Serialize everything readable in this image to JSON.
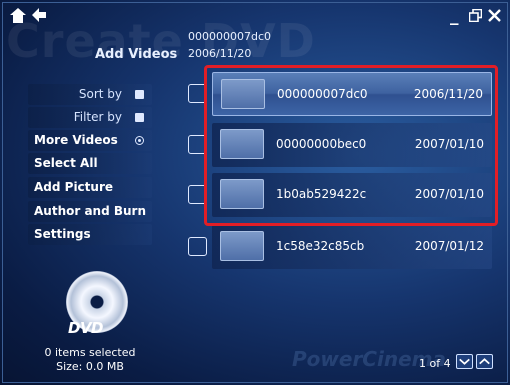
{
  "window": {
    "watermark": "Create DVD",
    "brand": "PowerCinema"
  },
  "header": {
    "title": "Add Videos",
    "current_id": "000000007dc0",
    "current_date": "2006/11/20"
  },
  "menu": {
    "sort_by": "Sort by",
    "filter_by": "Filter by",
    "more_videos": "More Videos",
    "select_all": "Select All",
    "add_picture": "Add Picture",
    "author_and_burn": "Author and Burn",
    "settings": "Settings"
  },
  "videos": [
    {
      "name": "000000007dc0",
      "date": "2006/11/20",
      "selected": true
    },
    {
      "name": "00000000bec0",
      "date": "2007/01/10",
      "selected": false
    },
    {
      "name": "1b0ab529422c",
      "date": "2007/01/10",
      "selected": false
    },
    {
      "name": "1c58e32c85cb",
      "date": "2007/01/12",
      "selected": false
    }
  ],
  "disc": {
    "logo": "DVD",
    "items_selected": "0 items selected",
    "size": "Size: 0.0 MB"
  },
  "pagination": {
    "text": "1 of 4"
  },
  "icons": {
    "home": "home-icon",
    "back": "back-arrow-icon",
    "minimize": "minimize-icon",
    "restore": "restore-icon",
    "close": "close-icon"
  }
}
